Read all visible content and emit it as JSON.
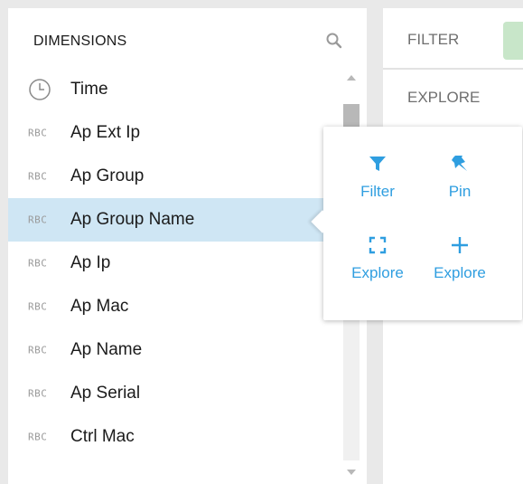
{
  "dimensions": {
    "title": "DIMENSIONS",
    "items": [
      {
        "icon": "clock-icon",
        "label": "Time"
      },
      {
        "icon": "RBC",
        "label": "Ap Ext Ip"
      },
      {
        "icon": "RBC",
        "label": "Ap Group"
      },
      {
        "icon": "RBC",
        "label": "Ap Group Name"
      },
      {
        "icon": "RBC",
        "label": "Ap Ip"
      },
      {
        "icon": "RBC",
        "label": "Ap Mac"
      },
      {
        "icon": "RBC",
        "label": "Ap Name"
      },
      {
        "icon": "RBC",
        "label": "Ap Serial"
      },
      {
        "icon": "RBC",
        "label": "Ctrl Mac"
      }
    ],
    "selected_label": "Ap Group Name"
  },
  "right_panel": {
    "filter_label": "FILTER",
    "explore_label": "EXPLORE"
  },
  "popover": {
    "actions": [
      {
        "icon": "filter-icon",
        "label": "Filter"
      },
      {
        "icon": "pin-icon",
        "label": "Pin"
      },
      {
        "icon": "fullscreen-icon",
        "label": "Explore"
      },
      {
        "icon": "plus-icon",
        "label": "Explore"
      }
    ]
  },
  "colors": {
    "accent": "#2f9ee0",
    "selected_row": "#cfe6f4",
    "filter_chip": "#c8e6c9"
  }
}
